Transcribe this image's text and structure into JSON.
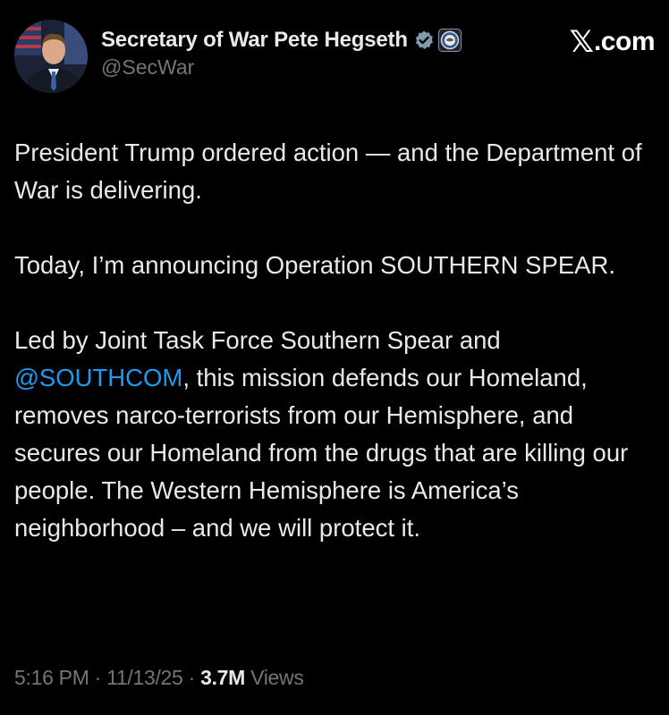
{
  "author": {
    "display_name": "Secretary of War Pete Hegseth",
    "handle": "@SecWar",
    "verified_icon": "verified-badge-icon",
    "affiliation_icon": "department-seal-icon"
  },
  "brand": {
    "x_glyph": "𝕏",
    "suffix": ".com"
  },
  "tweet": {
    "para1": "President Trump ordered action — and the Department of War is delivering.",
    "para2": "Today, I’m announcing Operation SOUTHERN SPEAR.",
    "para3_prefix": "Led by Joint Task Force Southern Spear and ",
    "para3_mention": "@SOUTHCOM",
    "para3_suffix": ", this mission defends our Homeland, removes narco-terrorists from our Hemisphere, and secures our Homeland from the drugs that are killing our people. The Western Hemisphere is America’s neighborhood – and we will protect it."
  },
  "meta": {
    "time": "5:16 PM",
    "sep1": " · ",
    "date": "11/13/25",
    "sep2": " · ",
    "views_count": "3.7M",
    "views_label": " Views"
  },
  "colors": {
    "background": "#000000",
    "text": "#e7e9ea",
    "secondary": "#71767b",
    "link": "#1d9bf0",
    "verified_grey": "#829aab"
  }
}
